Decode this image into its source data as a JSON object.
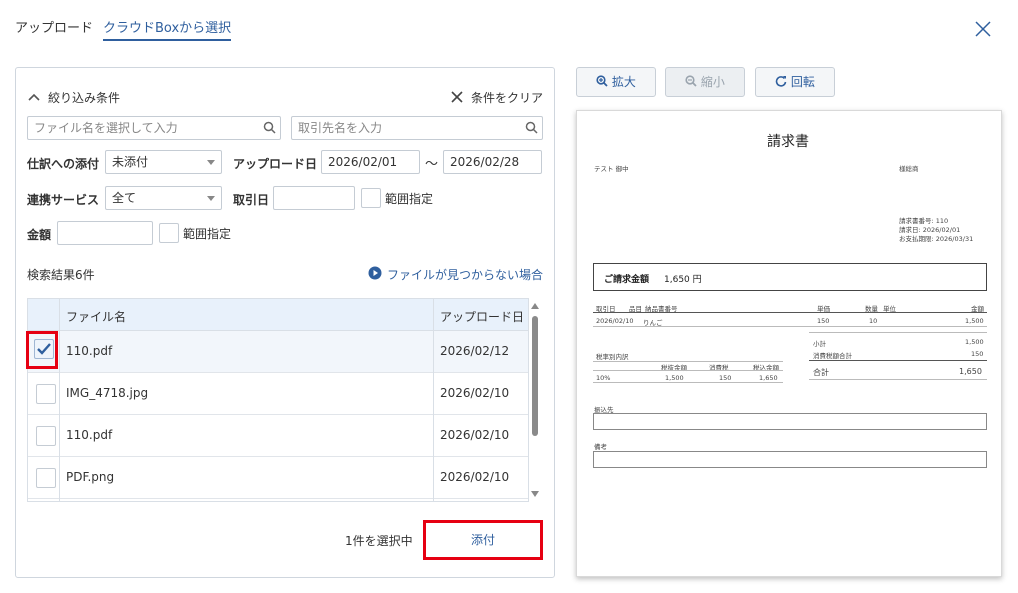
{
  "tabs": [
    {
      "label": "アップロード"
    },
    {
      "label": "クラウドBoxから選択"
    }
  ],
  "filter": {
    "header": "絞り込み条件",
    "clear": "条件をクリア",
    "file_search_placeholder": "ファイル名を選択して入力",
    "partner_placeholder": "取引先名を入力",
    "attach_label": "仕訳への添付",
    "attach_value": "未添付",
    "upload_date_label": "アップロード日",
    "upload_from": "2026/02/01",
    "tilde": "〜",
    "upload_to": "2026/02/28",
    "service_label": "連携サービス",
    "service_value": "全て",
    "tx_date_label": "取引日",
    "tx_range": "範囲指定",
    "amount_label": "金額",
    "amount_range": "範囲指定"
  },
  "results": {
    "count_text": "検索結果6件",
    "not_found_link": "ファイルが見つからない場合"
  },
  "table": {
    "headers": [
      "ファイル名",
      "アップロード日"
    ],
    "rows": [
      {
        "name": "110.pdf",
        "date": "2026/02/12",
        "checked": true
      },
      {
        "name": "IMG_4718.jpg",
        "date": "2026/02/10",
        "checked": false
      },
      {
        "name": "110.pdf",
        "date": "2026/02/10",
        "checked": false
      },
      {
        "name": "PDF.png",
        "date": "2026/02/10",
        "checked": false
      }
    ]
  },
  "footer": {
    "selected_text": "1件を選択中",
    "attach_button": "添付"
  },
  "preview_toolbar": {
    "zoom_in": "拡大",
    "zoom_out": "縮小",
    "rotate": "回転"
  },
  "invoice": {
    "title": "請求書",
    "to": "テスト 御中",
    "from": "様総商",
    "meta": [
      "請求書番号: 110",
      "請求日:       2026/02/01",
      "お支払期限: 2026/03/31"
    ],
    "total_label": "ご請求金額",
    "total_value": "1,650 円",
    "item_headers": [
      "取引日",
      "品目",
      "納品書番号",
      "単価",
      "数量",
      "単位",
      "金額"
    ],
    "item_row": [
      "2026/02/10",
      "りんご",
      "150",
      "10",
      "1,500"
    ],
    "subtotal_label": "小計",
    "subtotal_value": "1,500",
    "tax_label": "消費税額合計",
    "tax_value": "150",
    "grand_label": "合計",
    "grand_value": "1,650",
    "tax_breakdown_title": "税率別内訳",
    "tax_breakdown_headers": [
      "税抜金額",
      "消費税",
      "税込金額"
    ],
    "tax_breakdown_row": [
      "10%",
      "1,500",
      "150",
      "1,650"
    ],
    "bank_label": "振込先",
    "notes_label": "備考"
  },
  "colors": {
    "accent": "#2f5f9e",
    "highlight_red": "#e60012",
    "table_header": "#e8f1fb"
  }
}
